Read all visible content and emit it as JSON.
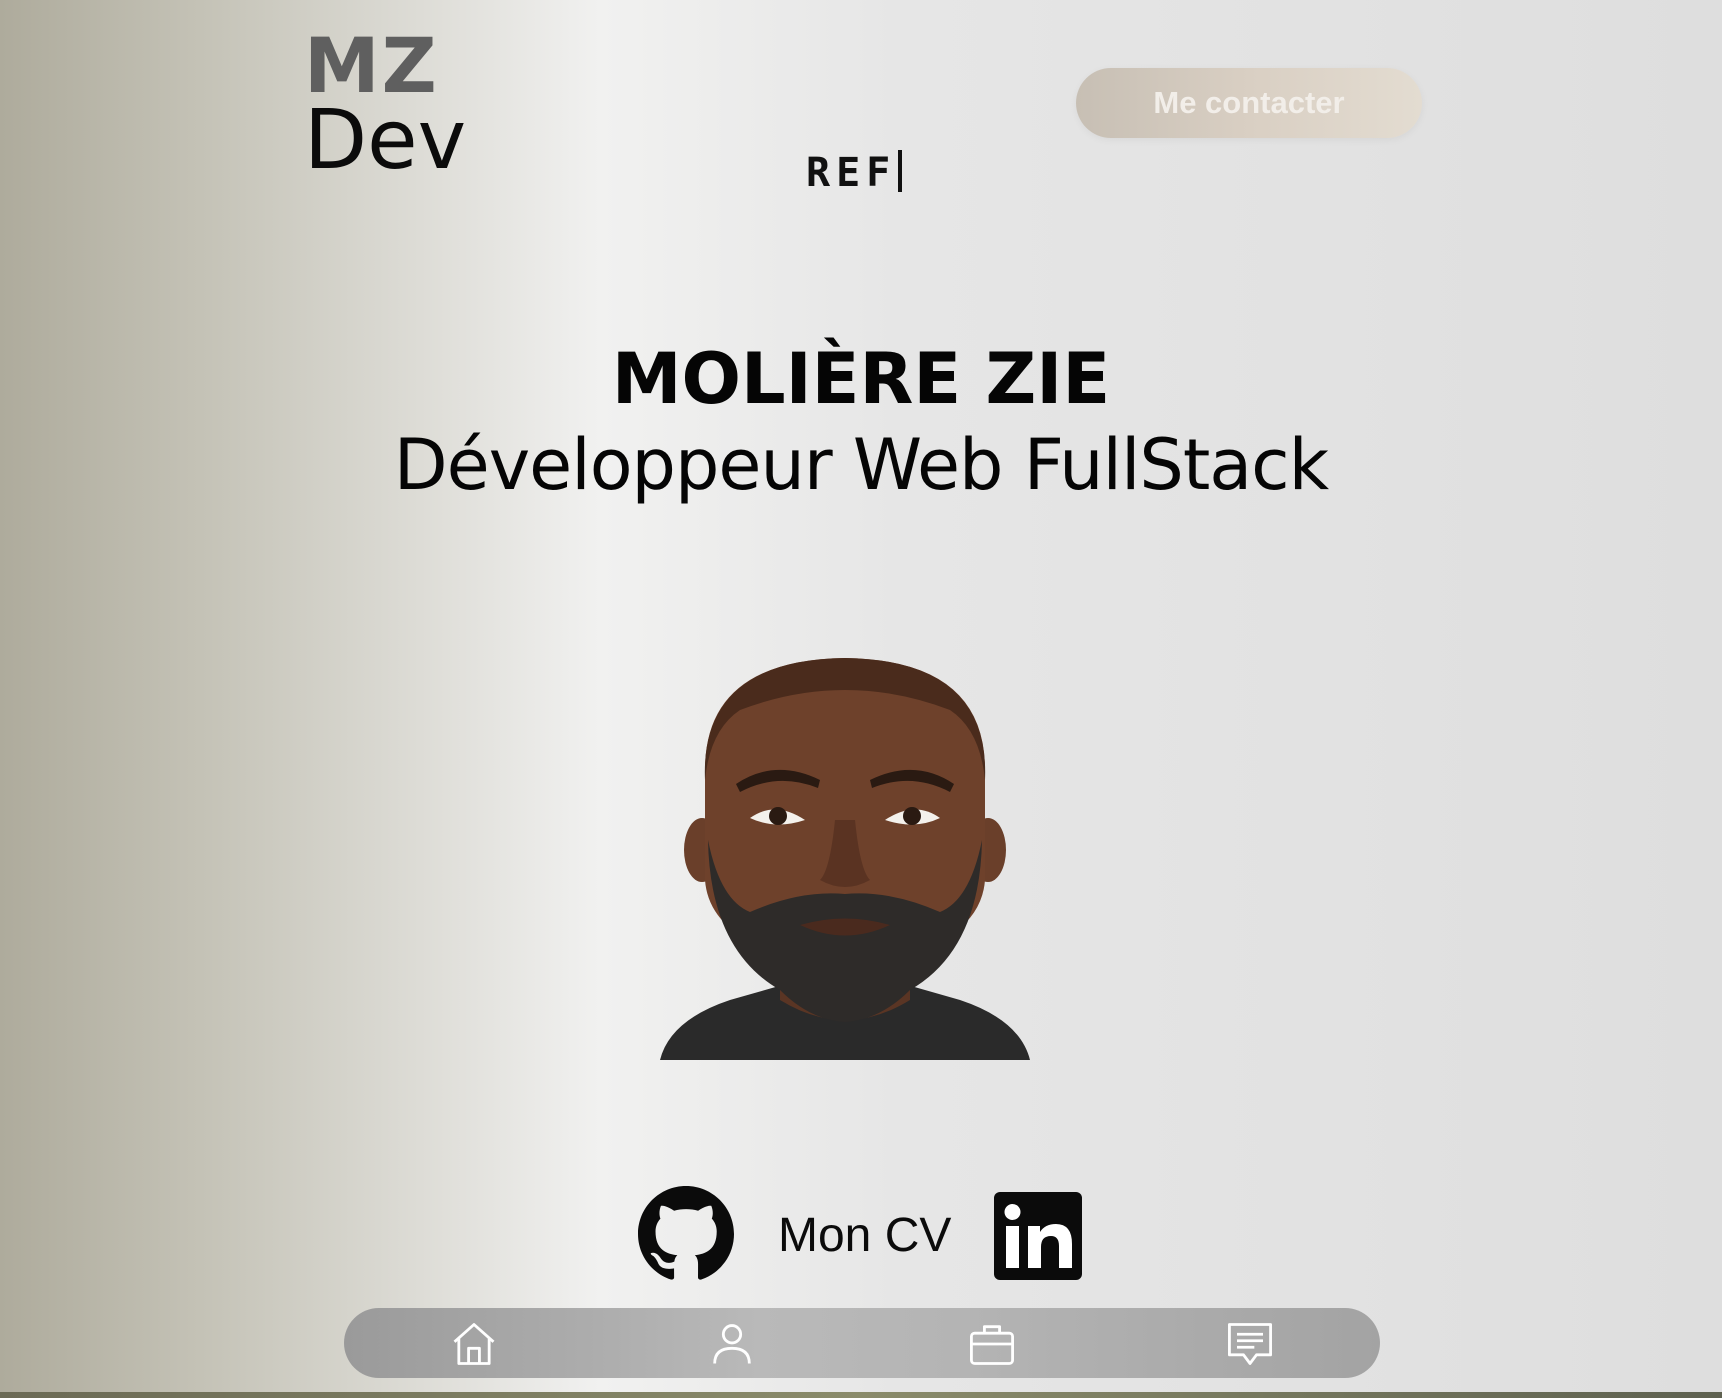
{
  "header": {
    "logo_top": "MZ",
    "logo_bottom": "Dev",
    "typing_text": "REF",
    "contact_button": "Me contacter"
  },
  "hero": {
    "name": "MOLIÈRE ZIE",
    "role": "Développeur Web FullStack"
  },
  "socials": {
    "github_icon": "github-icon",
    "cv_label": "Mon CV",
    "linkedin_icon": "linkedin-icon"
  },
  "bottom_nav": {
    "items": [
      "home-icon",
      "user-icon",
      "briefcase-icon",
      "message-icon"
    ]
  },
  "colors": {
    "text": "#050505",
    "logo_gray": "#5f5f5f",
    "button_bg": "#d9cfc3",
    "button_text": "#f2eee9",
    "nav_bg": "#b4b4b4"
  }
}
